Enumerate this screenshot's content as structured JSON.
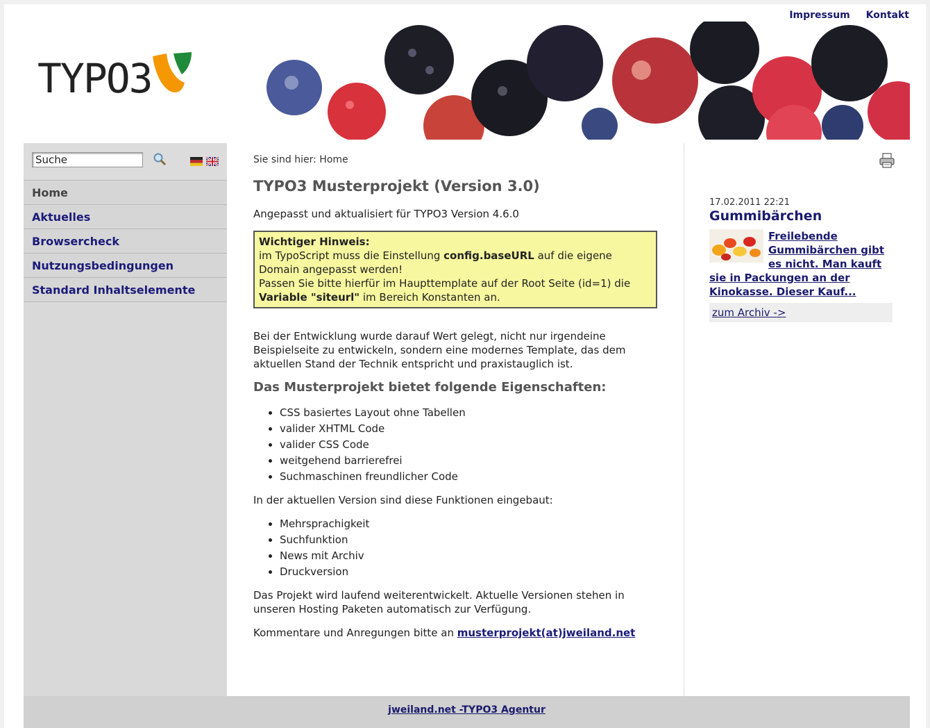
{
  "topnav": {
    "impressum": "Impressum",
    "kontakt": "Kontakt"
  },
  "header": {
    "logo_text": "TYPO3"
  },
  "search": {
    "value": "Suche"
  },
  "menu": [
    {
      "label": "Home"
    },
    {
      "label": "Aktuelles"
    },
    {
      "label": "Browsercheck"
    },
    {
      "label": "Nutzungsbedingungen"
    },
    {
      "label": "Standard Inhaltselemente"
    }
  ],
  "main": {
    "breadcrumb": "Sie sind hier: Home",
    "title": "TYPO3 Musterprojekt (Version 3.0)",
    "intro": "Angepasst und aktualisiert für TYPO3 Version 4.6.0",
    "hint": {
      "heading": "Wichtiger Hinweis:",
      "line1_a": "im TypoScript muss die Einstellung ",
      "line1_b": "config.baseURL",
      "line1_c": " auf die eigene Domain angepasst werden!",
      "line2_a": "Passen Sie bitte hierfür im Haupttemplate auf der Root Seite (id=1) die ",
      "line2_b": "Variable \"siteurl\"",
      "line2_c": " im Bereich Konstanten an."
    },
    "para1": "Bei der Entwicklung wurde darauf Wert gelegt, nicht nur irgendeine Beispielseite zu entwickeln, sondern eine modernes Template, das dem aktuellen Stand der Technik entspricht und praxistauglich ist.",
    "subtitle": "Das Musterprojekt bietet folgende Eigenschaften:",
    "features": [
      "CSS basiertes Layout ohne Tabellen",
      "valider XHTML Code",
      "valider CSS Code",
      "weitgehend barrierefrei",
      "Suchmaschinen freundlicher Code"
    ],
    "para2": "In der aktuellen Version sind diese Funktionen eingebaut:",
    "functions": [
      "Mehrsprachigkeit",
      "Suchfunktion",
      "News mit Archiv",
      "Druckversion"
    ],
    "para3": "Das Projekt wird laufend weiterentwickelt. Aktuelle Versionen stehen in unseren Hosting Paketen automatisch zur Verfügung.",
    "para4_prefix": "Kommentare und Anregungen bitte an ",
    "mail": "musterprojekt(at)jweiland.net"
  },
  "news": {
    "date": "17.02.2011 22:21",
    "title": "Gummibärchen",
    "text_a": "Freilebende Gummibärchen gibt es nicht. Man kauft",
    "text_b": "sie in Packungen an der Kinokasse. Dieser Kauf...",
    "archive": "zum Archiv ->"
  },
  "footer": {
    "link": "jweiland.net -TYPO3 Agentur"
  },
  "colors": {
    "link": "#1a1a6e",
    "hint_bg": "#f7f7a0",
    "sidebar_bg": "#d9d9d9",
    "logo_orange": "#f49700",
    "logo_green": "#1f8a3a"
  }
}
